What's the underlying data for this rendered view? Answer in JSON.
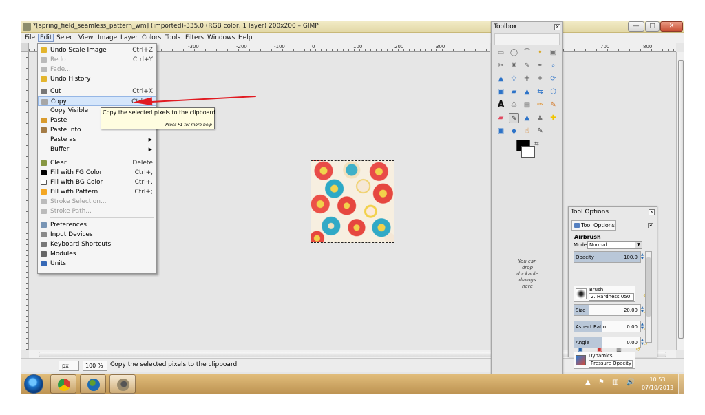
{
  "window": {
    "title": "*[spring_field_seamless_pattern_wm] (imported)-335.0 (RGB color, 1 layer) 200x200 – GIMP",
    "minimize": "—",
    "maximize": "□",
    "close": "✕"
  },
  "menubar": [
    "File",
    "Edit",
    "Select",
    "View",
    "Image",
    "Layer",
    "Colors",
    "Tools",
    "Filters",
    "Windows",
    "Help"
  ],
  "ruler": {
    "top": [
      "-300",
      "-200",
      "-100",
      "0",
      "100",
      "200",
      "300"
    ],
    "right": [
      "700",
      "800"
    ]
  },
  "edit_menu": {
    "items": [
      {
        "label": "Undo Scale Image",
        "shortcut": "Ctrl+Z",
        "icon": "undo-icon",
        "disabled": false
      },
      {
        "label": "Redo",
        "shortcut": "Ctrl+Y",
        "icon": "redo-icon",
        "disabled": true
      },
      {
        "label": "Fade...",
        "shortcut": "",
        "icon": "fade-icon",
        "disabled": true
      },
      {
        "label": "Undo History",
        "shortcut": "",
        "icon": "history-icon",
        "disabled": false
      },
      {
        "label": "Cut",
        "shortcut": "Ctrl+X",
        "icon": "cut-icon",
        "disabled": false
      },
      {
        "label": "Copy",
        "shortcut": "Ctrl+C",
        "icon": "copy-icon",
        "disabled": false
      },
      {
        "label": "Copy Visible",
        "shortcut": "",
        "icon": "",
        "disabled": false
      },
      {
        "label": "Paste",
        "shortcut": "",
        "icon": "paste-icon",
        "disabled": false
      },
      {
        "label": "Paste Into",
        "shortcut": "",
        "icon": "paste-into-icon",
        "disabled": false
      },
      {
        "label": "Paste as",
        "shortcut": "",
        "icon": "",
        "disabled": false,
        "submenu": true
      },
      {
        "label": "Buffer",
        "shortcut": "",
        "icon": "",
        "disabled": false,
        "submenu": true
      },
      {
        "label": "Clear",
        "shortcut": "Delete",
        "icon": "clear-icon",
        "disabled": false
      },
      {
        "label": "Fill with FG Color",
        "shortcut": "Ctrl+,",
        "icon": "fill-fg-icon",
        "disabled": false
      },
      {
        "label": "Fill with BG Color",
        "shortcut": "Ctrl+.",
        "icon": "fill-bg-icon",
        "disabled": false
      },
      {
        "label": "Fill with Pattern",
        "shortcut": "Ctrl+;",
        "icon": "fill-pattern-icon",
        "disabled": false
      },
      {
        "label": "Stroke Selection...",
        "shortcut": "",
        "icon": "stroke-selection-icon",
        "disabled": true
      },
      {
        "label": "Stroke Path...",
        "shortcut": "",
        "icon": "stroke-path-icon",
        "disabled": true
      },
      {
        "label": "Preferences",
        "shortcut": "",
        "icon": "preferences-icon",
        "disabled": false
      },
      {
        "label": "Input Devices",
        "shortcut": "",
        "icon": "input-devices-icon",
        "disabled": false
      },
      {
        "label": "Keyboard Shortcuts",
        "shortcut": "",
        "icon": "keyboard-icon",
        "disabled": false
      },
      {
        "label": "Modules",
        "shortcut": "",
        "icon": "modules-icon",
        "disabled": false
      },
      {
        "label": "Units",
        "shortcut": "",
        "icon": "units-icon",
        "disabled": false
      }
    ]
  },
  "tooltip": {
    "main": "Copy the selected pixels to the clipboard",
    "help": "Press F1 for more help"
  },
  "statusbar": {
    "unit": "px",
    "zoom": "100 %",
    "message": "Copy the selected pixels to the clipboard"
  },
  "toolbox": {
    "title": "Toolbox",
    "drop_hint": "You can drop dockable dialogs here",
    "colors": {
      "foreground": "#000000",
      "background": "#ffffff"
    }
  },
  "tool_options": {
    "title": "Tool Options",
    "tab": "Tool Options",
    "tool_name": "Airbrush",
    "mode_label": "Mode:",
    "mode_value": "Normal",
    "opacity_label": "Opacity",
    "opacity_value": "100.0",
    "brush_label": "Brush",
    "brush_value": "2. Hardness 050",
    "size_label": "Size",
    "size_value": "20.00",
    "aspect_label": "Aspect Ratio",
    "aspect_value": "0.00",
    "angle_label": "Angle",
    "angle_value": "0.00",
    "dynamics_label": "Dynamics",
    "dynamics_value": "Pressure Opacity"
  },
  "taskbar": {
    "time": "10:53",
    "date": "07/10/2013"
  }
}
